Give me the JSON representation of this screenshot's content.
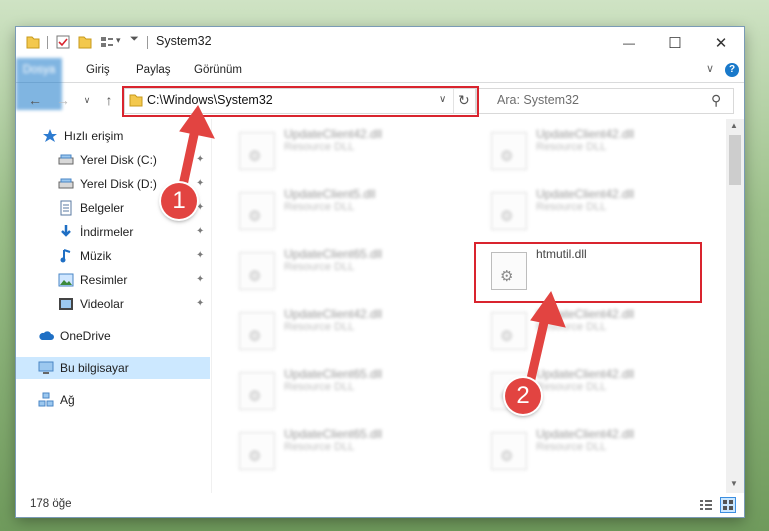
{
  "window": {
    "title": "System32",
    "minimize": "—",
    "maximize": "☐",
    "close": "✕"
  },
  "ribbon": {
    "tabs": [
      "Dosya",
      "Giriş",
      "Paylaş",
      "Görünüm"
    ],
    "collapse": "∨",
    "help": "?"
  },
  "nav": {
    "back": "←",
    "forward": "→",
    "recent": "∨",
    "up": "↑",
    "address": "C:\\Windows\\System32",
    "address_dropdown": "∨",
    "refresh": "↻",
    "search_placeholder": "Ara: System32",
    "search_icon": "⚲"
  },
  "sidebar": {
    "items": [
      {
        "label": "Hızlı erişim",
        "icon": "star-icon",
        "pinned": false
      },
      {
        "label": "Yerel Disk (C:)",
        "icon": "drive-icon",
        "pinned": true
      },
      {
        "label": "Yerel Disk (D:)",
        "icon": "drive-icon",
        "pinned": true
      },
      {
        "label": "Belgeler",
        "icon": "document-icon",
        "pinned": true
      },
      {
        "label": "İndirmeler",
        "icon": "download-icon",
        "pinned": true
      },
      {
        "label": "Müzik",
        "icon": "music-icon",
        "pinned": true
      },
      {
        "label": "Resimler",
        "icon": "pictures-icon",
        "pinned": true
      },
      {
        "label": "Videolar",
        "icon": "video-icon",
        "pinned": true
      },
      {
        "label": "OneDrive",
        "icon": "cloud-icon",
        "pinned": false
      },
      {
        "label": "Bu bilgisayar",
        "icon": "computer-icon",
        "pinned": false
      },
      {
        "label": "Ağ",
        "icon": "network-icon",
        "pinned": false
      }
    ],
    "pin_glyph": "📌"
  },
  "files": [
    {
      "name": "UpdateClient42.dll",
      "type": "Resource DLL"
    },
    {
      "name": "UpdateClient42.dll",
      "type": "Resource DLL"
    },
    {
      "name": "UpdateClient5.dll",
      "type": "Resource DLL"
    },
    {
      "name": "UpdateClient42.dll",
      "type": "Resource DLL"
    },
    {
      "name": "UpdateClient65.dll",
      "type": "Resource DLL"
    },
    {
      "name": "htmutil.dll",
      "type": ""
    },
    {
      "name": "UpdateClient42.dll",
      "type": "Resource DLL"
    },
    {
      "name": "UpdateClient42.dll",
      "type": "Resource DLL"
    },
    {
      "name": "UpdateClient65.dll",
      "type": "Resource DLL"
    },
    {
      "name": "UpdateClient42.dll",
      "type": "Resource DLL"
    },
    {
      "name": "UpdateClient65.dll",
      "type": "Resource DLL"
    },
    {
      "name": "UpdateClient42.dll",
      "type": "Resource DLL"
    }
  ],
  "status": {
    "count": "178 öğe"
  },
  "annotations": {
    "badge1": "1",
    "badge2": "2",
    "color": "#e24441"
  }
}
